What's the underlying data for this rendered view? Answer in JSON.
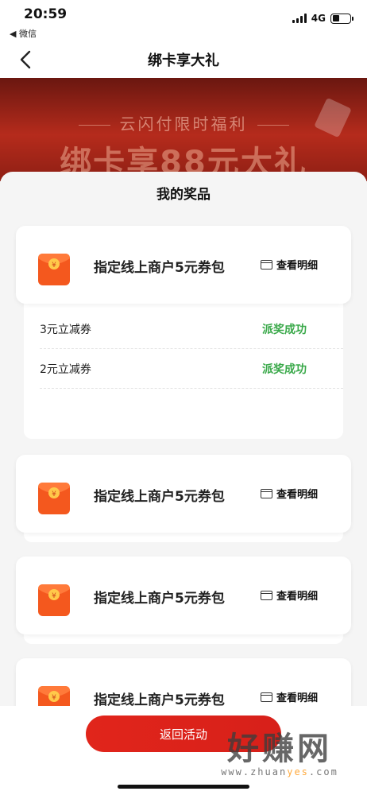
{
  "status_bar": {
    "time": "20:59",
    "back_app": "◀ 微信",
    "network": "4G"
  },
  "nav": {
    "title": "绑卡享大礼"
  },
  "banner": {
    "subtitle": "云闪付限时福利",
    "headline": "绑卡享88元大礼"
  },
  "sheet": {
    "title": "我的奖品",
    "prizes": [
      {
        "name": "指定线上商户5元券包",
        "detail_label": "查看明细",
        "coupons": [
          {
            "name": "3元立减券",
            "status": "派奖成功"
          },
          {
            "name": "2元立减券",
            "status": "派奖成功"
          }
        ]
      },
      {
        "name": "指定线上商户5元券包",
        "detail_label": "查看明细"
      },
      {
        "name": "指定线上商户5元券包",
        "detail_label": "查看明细"
      },
      {
        "name": "指定线上商户5元券包",
        "detail_label": "查看明细"
      }
    ]
  },
  "bottom": {
    "return_label": "返回活动"
  },
  "watermark": {
    "big": "好赚网",
    "small_pre": "www.zhuan",
    "small_hl": "yes",
    "small_post": ".com"
  },
  "colors": {
    "accent_red": "#e1251b",
    "success_green": "#3aa94a",
    "envelope_orange": "#f4581e"
  }
}
